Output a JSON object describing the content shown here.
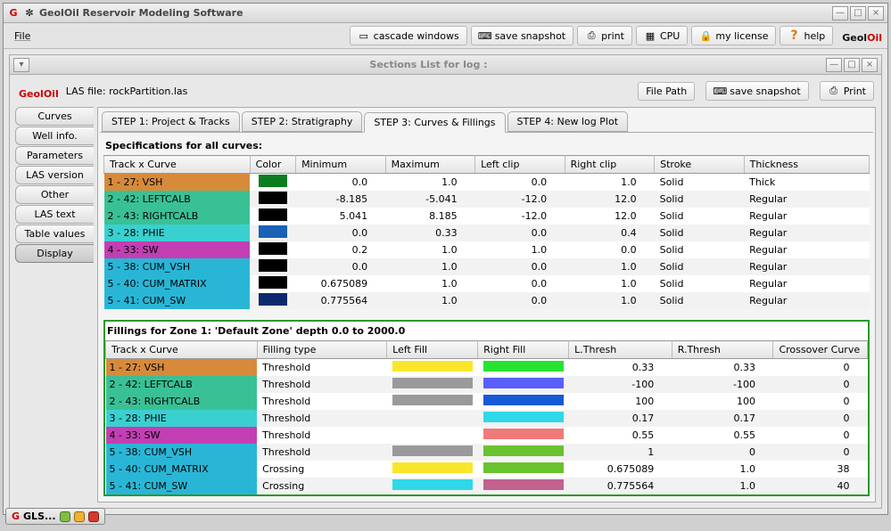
{
  "window": {
    "title": "GeolOil Reservoir Modeling Software",
    "menu_file": "File",
    "toolbar": {
      "cascade": "cascade windows",
      "snapshot": "save snapshot",
      "print": "print",
      "cpu": "CPU",
      "license": "my license",
      "help": "help"
    },
    "logo_a": "Geol",
    "logo_b": "Oil"
  },
  "sub": {
    "title": "Sections List for log :",
    "las_label": "LAS file: rockPartition.las",
    "btn_filepath": "File Path",
    "btn_snapshot": "save snapshot",
    "btn_print": "Print"
  },
  "sidetabs": [
    "Curves",
    "Well info.",
    "Parameters",
    "LAS version",
    "Other",
    "LAS text",
    "Table values",
    "Display"
  ],
  "sidetab_sel": 7,
  "steps": [
    "STEP 1: Project & Tracks",
    "STEP 2: Stratigraphy",
    "STEP 3: Curves & Fillings",
    "STEP 4: New log Plot"
  ],
  "step_sel": 2,
  "spec": {
    "title": "Specifications for all curves:",
    "cols": [
      "Track x Curve",
      "Color",
      "Minimum",
      "Maximum",
      "Left clip",
      "Right clip",
      "Stroke",
      "Thickness"
    ],
    "rows": [
      {
        "label": "1 - 27: VSH",
        "bg": "#d68a3a",
        "color": "#0a7d1f",
        "min": "0.0",
        "max": "1.0",
        "lc": "0.0",
        "rc": "1.0",
        "stroke": "Solid",
        "thick": "Thick"
      },
      {
        "label": "2 - 42: LEFTCALB",
        "bg": "#39c195",
        "color": "#000000",
        "min": "-8.185",
        "max": "-5.041",
        "lc": "-12.0",
        "rc": "12.0",
        "stroke": "Solid",
        "thick": "Regular"
      },
      {
        "label": "2 - 43: RIGHTCALB",
        "bg": "#39c195",
        "color": "#000000",
        "min": "5.041",
        "max": "8.185",
        "lc": "-12.0",
        "rc": "12.0",
        "stroke": "Solid",
        "thick": "Regular"
      },
      {
        "label": "3 - 28: PHIE",
        "bg": "#3ad0d0",
        "color": "#1a62b5",
        "min": "0.0",
        "max": "0.33",
        "lc": "0.0",
        "rc": "0.4",
        "stroke": "Solid",
        "thick": "Regular"
      },
      {
        "label": "4 - 33: SW",
        "bg": "#c23fb3",
        "color": "#000000",
        "min": "0.2",
        "max": "1.0",
        "lc": "1.0",
        "rc": "0.0",
        "stroke": "Solid",
        "thick": "Regular"
      },
      {
        "label": "5 - 38: CUM_VSH",
        "bg": "#29b6d6",
        "color": "#000000",
        "min": "0.0",
        "max": "1.0",
        "lc": "0.0",
        "rc": "1.0",
        "stroke": "Solid",
        "thick": "Regular"
      },
      {
        "label": "5 - 40: CUM_MATRIX",
        "bg": "#29b6d6",
        "color": "#000000",
        "min": "0.675089",
        "max": "1.0",
        "lc": "0.0",
        "rc": "1.0",
        "stroke": "Solid",
        "thick": "Regular"
      },
      {
        "label": "5 - 41: CUM_SW",
        "bg": "#29b6d6",
        "color": "#0a2a6d",
        "min": "0.775564",
        "max": "1.0",
        "lc": "0.0",
        "rc": "1.0",
        "stroke": "Solid",
        "thick": "Regular"
      }
    ]
  },
  "fill": {
    "title": "Fillings for Zone 1: 'Default Zone' depth 0.0 to 2000.0",
    "cols": [
      "Track x Curve",
      "Filling type",
      "Left Fill",
      "Right Fill",
      "L.Thresh",
      "R.Thresh",
      "Crossover Curve"
    ],
    "rows": [
      {
        "label": "1 - 27: VSH",
        "bg": "#d68a3a",
        "type": "Threshold",
        "lf": "#f9e62b",
        "rf": "#27e331",
        "lt": "0.33",
        "rt": "0.33",
        "cc": "0"
      },
      {
        "label": "2 - 42: LEFTCALB",
        "bg": "#39c195",
        "type": "Threshold",
        "lf": "#9a9a9a",
        "rf": "#5a5fff",
        "lt": "-100",
        "rt": "-100",
        "cc": "0"
      },
      {
        "label": "2 - 43: RIGHTCALB",
        "bg": "#39c195",
        "type": "Threshold",
        "lf": "#9a9a9a",
        "rf": "#1658d6",
        "lt": "100",
        "rt": "100",
        "cc": "0"
      },
      {
        "label": "3 - 28: PHIE",
        "bg": "#3ad0d0",
        "type": "Threshold",
        "lf": "",
        "rf": "#2fd8e8",
        "lt": "0.17",
        "rt": "0.17",
        "cc": "0"
      },
      {
        "label": "4 - 33: SW",
        "bg": "#c23fb3",
        "type": "Threshold",
        "lf": "",
        "rf": "#f07a7a",
        "lt": "0.55",
        "rt": "0.55",
        "cc": "0"
      },
      {
        "label": "5 - 38: CUM_VSH",
        "bg": "#29b6d6",
        "type": "Threshold",
        "lf": "#9a9a9a",
        "rf": "#6ac22f",
        "lt": "1",
        "rt": "0",
        "cc": "0"
      },
      {
        "label": "5 - 40: CUM_MATRIX",
        "bg": "#29b6d6",
        "type": "Crossing",
        "lf": "#f9e62b",
        "rf": "#6ac22f",
        "lt": "0.675089",
        "rt": "1.0",
        "cc": "38"
      },
      {
        "label": "5 - 41: CUM_SW",
        "bg": "#29b6d6",
        "type": "Crossing",
        "lf": "#2fd8e8",
        "rf": "#c2628e",
        "lt": "0.775564",
        "rt": "1.0",
        "cc": "40"
      }
    ]
  },
  "taskbar": {
    "label": "GLS..."
  }
}
